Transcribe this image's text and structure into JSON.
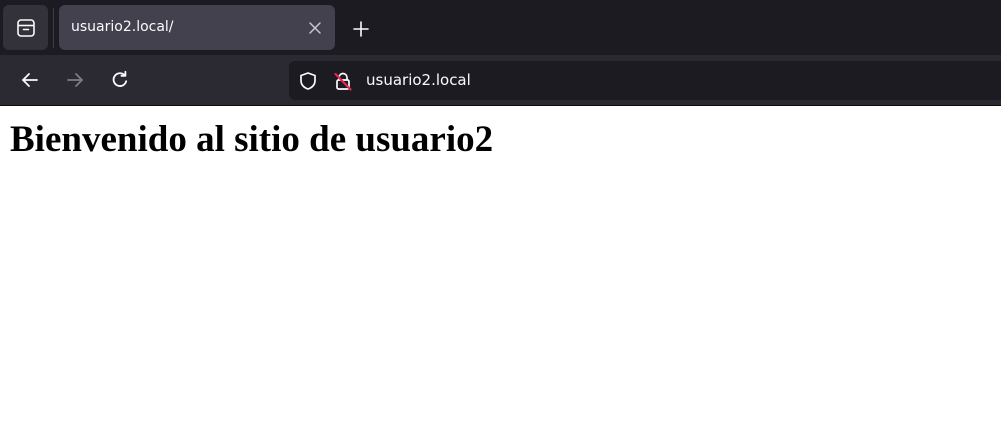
{
  "tab_strip": {
    "active_tab": {
      "title": "usuario2.local/",
      "close_icon": "close-icon"
    },
    "tab_list_icon": "tab-list-icon",
    "new_tab_icon": "plus-icon"
  },
  "nav_bar": {
    "back_icon": "arrow-left-icon",
    "forward_icon": "arrow-right-icon",
    "forward_enabled": false,
    "reload_icon": "reload-icon",
    "url_bar": {
      "shield_icon": "shield-icon",
      "insecure_lock_icon": "insecure-lock-icon",
      "url": "usuario2.local"
    }
  },
  "page": {
    "heading": "Bienvenido al sitio de usuario2"
  },
  "colors": {
    "tab_strip_bg": "#1c1b22",
    "active_tab_bg": "#42414d",
    "nav_bar_bg": "#2b2a33",
    "url_bar_bg": "#1c1b22",
    "text_light": "#fbfbfe",
    "insecure_accent": "#e22850",
    "page_bg": "#ffffff",
    "page_text": "#000000"
  }
}
